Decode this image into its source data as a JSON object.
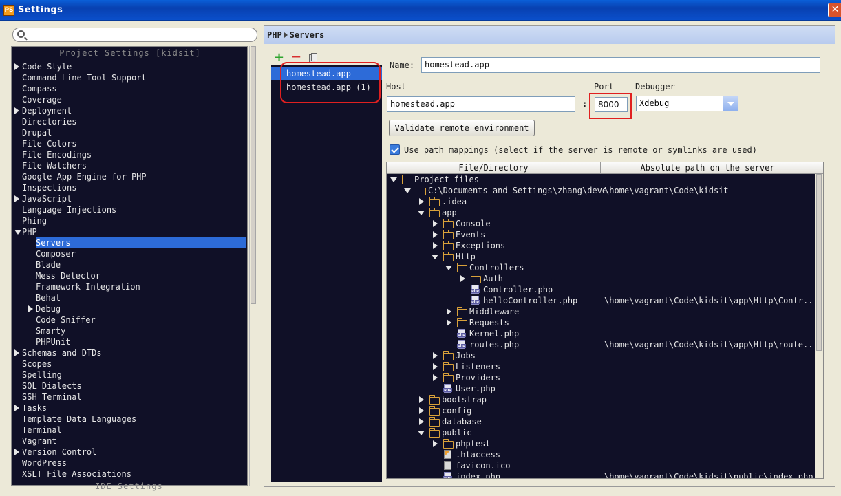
{
  "window": {
    "title": "Settings",
    "app_icon_text": "PS",
    "close_glyph": "✕"
  },
  "search": {
    "placeholder": "",
    "value": ""
  },
  "left_tree": {
    "section_header": "Project Settings [kidsit]",
    "footer_header": "IDE Settings",
    "items": [
      {
        "label": "Code Style",
        "level": 0,
        "arrow": "right"
      },
      {
        "label": "Command Line Tool Support",
        "level": 0,
        "arrow": ""
      },
      {
        "label": "Compass",
        "level": 0,
        "arrow": ""
      },
      {
        "label": "Coverage",
        "level": 0,
        "arrow": ""
      },
      {
        "label": "Deployment",
        "level": 0,
        "arrow": "right"
      },
      {
        "label": "Directories",
        "level": 0,
        "arrow": ""
      },
      {
        "label": "Drupal",
        "level": 0,
        "arrow": ""
      },
      {
        "label": "File Colors",
        "level": 0,
        "arrow": ""
      },
      {
        "label": "File Encodings",
        "level": 0,
        "arrow": ""
      },
      {
        "label": "File Watchers",
        "level": 0,
        "arrow": ""
      },
      {
        "label": "Google App Engine for PHP",
        "level": 0,
        "arrow": ""
      },
      {
        "label": "Inspections",
        "level": 0,
        "arrow": ""
      },
      {
        "label": "JavaScript",
        "level": 0,
        "arrow": "right"
      },
      {
        "label": "Language Injections",
        "level": 0,
        "arrow": ""
      },
      {
        "label": "Phing",
        "level": 0,
        "arrow": ""
      },
      {
        "label": "PHP",
        "level": 0,
        "arrow": "down"
      },
      {
        "label": "Servers",
        "level": 1,
        "arrow": "",
        "selected": true
      },
      {
        "label": "Composer",
        "level": 1,
        "arrow": ""
      },
      {
        "label": "Blade",
        "level": 1,
        "arrow": ""
      },
      {
        "label": "Mess Detector",
        "level": 1,
        "arrow": ""
      },
      {
        "label": "Framework Integration",
        "level": 1,
        "arrow": ""
      },
      {
        "label": "Behat",
        "level": 1,
        "arrow": ""
      },
      {
        "label": "Debug",
        "level": 1,
        "arrow": "right"
      },
      {
        "label": "Code Sniffer",
        "level": 1,
        "arrow": ""
      },
      {
        "label": "Smarty",
        "level": 1,
        "arrow": ""
      },
      {
        "label": "PHPUnit",
        "level": 1,
        "arrow": ""
      },
      {
        "label": "Schemas and DTDs",
        "level": 0,
        "arrow": "right"
      },
      {
        "label": "Scopes",
        "level": 0,
        "arrow": ""
      },
      {
        "label": "Spelling",
        "level": 0,
        "arrow": ""
      },
      {
        "label": "SQL Dialects",
        "level": 0,
        "arrow": ""
      },
      {
        "label": "SSH Terminal",
        "level": 0,
        "arrow": ""
      },
      {
        "label": "Tasks",
        "level": 0,
        "arrow": "right"
      },
      {
        "label": "Template Data Languages",
        "level": 0,
        "arrow": ""
      },
      {
        "label": "Terminal",
        "level": 0,
        "arrow": ""
      },
      {
        "label": "Vagrant",
        "level": 0,
        "arrow": ""
      },
      {
        "label": "Version Control",
        "level": 0,
        "arrow": "right"
      },
      {
        "label": "WordPress",
        "level": 0,
        "arrow": ""
      },
      {
        "label": "XSLT File Associations",
        "level": 0,
        "arrow": ""
      }
    ]
  },
  "breadcrumb": {
    "parent": "PHP",
    "current": "Servers"
  },
  "server_toolbar": {
    "add": "+",
    "remove": "−",
    "copy_icon": "copy-icon"
  },
  "servers": [
    {
      "label": "homestead.app",
      "selected": true
    },
    {
      "label": "homestead.app (1)",
      "selected": false
    }
  ],
  "form": {
    "name_label": "Name:",
    "name_value": "homestead.app",
    "host_label": "Host",
    "host_value": "homestead.app",
    "port_label": "Port",
    "port_value": "8000",
    "colon": ":",
    "debugger_label": "Debugger",
    "debugger_value": "Xdebug",
    "validate_button": "Validate remote environment",
    "use_path_mappings_label": "Use path mappings (select if the server is remote or symlinks are used)",
    "use_path_mappings_checked": true
  },
  "mappings": {
    "col_file": "File/Directory",
    "col_path": "Absolute path on the server",
    "rows": [
      {
        "label": "Project files",
        "depth": 0,
        "arrow": "down",
        "icon": "folder",
        "path": ""
      },
      {
        "label": "C:\\Documents and Settings\\zhang\\deve",
        "depth": 1,
        "arrow": "down",
        "icon": "folder",
        "path": "\\home\\vagrant\\Code\\kidsit"
      },
      {
        "label": ".idea",
        "depth": 2,
        "arrow": "right",
        "icon": "folder",
        "path": ""
      },
      {
        "label": "app",
        "depth": 2,
        "arrow": "down",
        "icon": "folder",
        "path": ""
      },
      {
        "label": "Console",
        "depth": 3,
        "arrow": "right",
        "icon": "folder",
        "path": ""
      },
      {
        "label": "Events",
        "depth": 3,
        "arrow": "right",
        "icon": "folder",
        "path": ""
      },
      {
        "label": "Exceptions",
        "depth": 3,
        "arrow": "right",
        "icon": "folder",
        "path": ""
      },
      {
        "label": "Http",
        "depth": 3,
        "arrow": "down",
        "icon": "folder",
        "path": ""
      },
      {
        "label": "Controllers",
        "depth": 4,
        "arrow": "down",
        "icon": "folder",
        "path": ""
      },
      {
        "label": "Auth",
        "depth": 5,
        "arrow": "right",
        "icon": "folder",
        "path": ""
      },
      {
        "label": "Controller.php",
        "depth": 5,
        "arrow": "",
        "icon": "php",
        "path": ""
      },
      {
        "label": "helloController.php",
        "depth": 5,
        "arrow": "",
        "icon": "php",
        "path": "\\home\\vagrant\\Code\\kidsit\\app\\Http\\Contr..."
      },
      {
        "label": "Middleware",
        "depth": 4,
        "arrow": "right",
        "icon": "folder",
        "path": ""
      },
      {
        "label": "Requests",
        "depth": 4,
        "arrow": "right",
        "icon": "folder",
        "path": ""
      },
      {
        "label": "Kernel.php",
        "depth": 4,
        "arrow": "",
        "icon": "php",
        "path": ""
      },
      {
        "label": "routes.php",
        "depth": 4,
        "arrow": "",
        "icon": "php",
        "path": "\\home\\vagrant\\Code\\kidsit\\app\\Http\\route..."
      },
      {
        "label": "Jobs",
        "depth": 3,
        "arrow": "right",
        "icon": "folder",
        "path": ""
      },
      {
        "label": "Listeners",
        "depth": 3,
        "arrow": "right",
        "icon": "folder",
        "path": ""
      },
      {
        "label": "Providers",
        "depth": 3,
        "arrow": "right",
        "icon": "folder",
        "path": ""
      },
      {
        "label": "User.php",
        "depth": 3,
        "arrow": "",
        "icon": "php",
        "path": ""
      },
      {
        "label": "bootstrap",
        "depth": 2,
        "arrow": "right",
        "icon": "folder",
        "path": ""
      },
      {
        "label": "config",
        "depth": 2,
        "arrow": "right",
        "icon": "folder",
        "path": ""
      },
      {
        "label": "database",
        "depth": 2,
        "arrow": "right",
        "icon": "folder",
        "path": ""
      },
      {
        "label": "public",
        "depth": 2,
        "arrow": "down",
        "icon": "folder",
        "path": ""
      },
      {
        "label": "phptest",
        "depth": 3,
        "arrow": "right",
        "icon": "folder",
        "path": ""
      },
      {
        "label": ".htaccess",
        "depth": 3,
        "arrow": "",
        "icon": "htaccess",
        "path": ""
      },
      {
        "label": "favicon.ico",
        "depth": 3,
        "arrow": "",
        "icon": "file",
        "path": ""
      },
      {
        "label": "index.php",
        "depth": 3,
        "arrow": "",
        "icon": "php",
        "path": "\\home\\vagrant\\Code\\kidsit\\public\\index.php"
      }
    ]
  },
  "colors": {
    "accent": "#2d6bd8",
    "highlight_box": "#e02020",
    "tree_bg": "#101027",
    "add": "#2ea42e",
    "remove": "#d83030"
  }
}
